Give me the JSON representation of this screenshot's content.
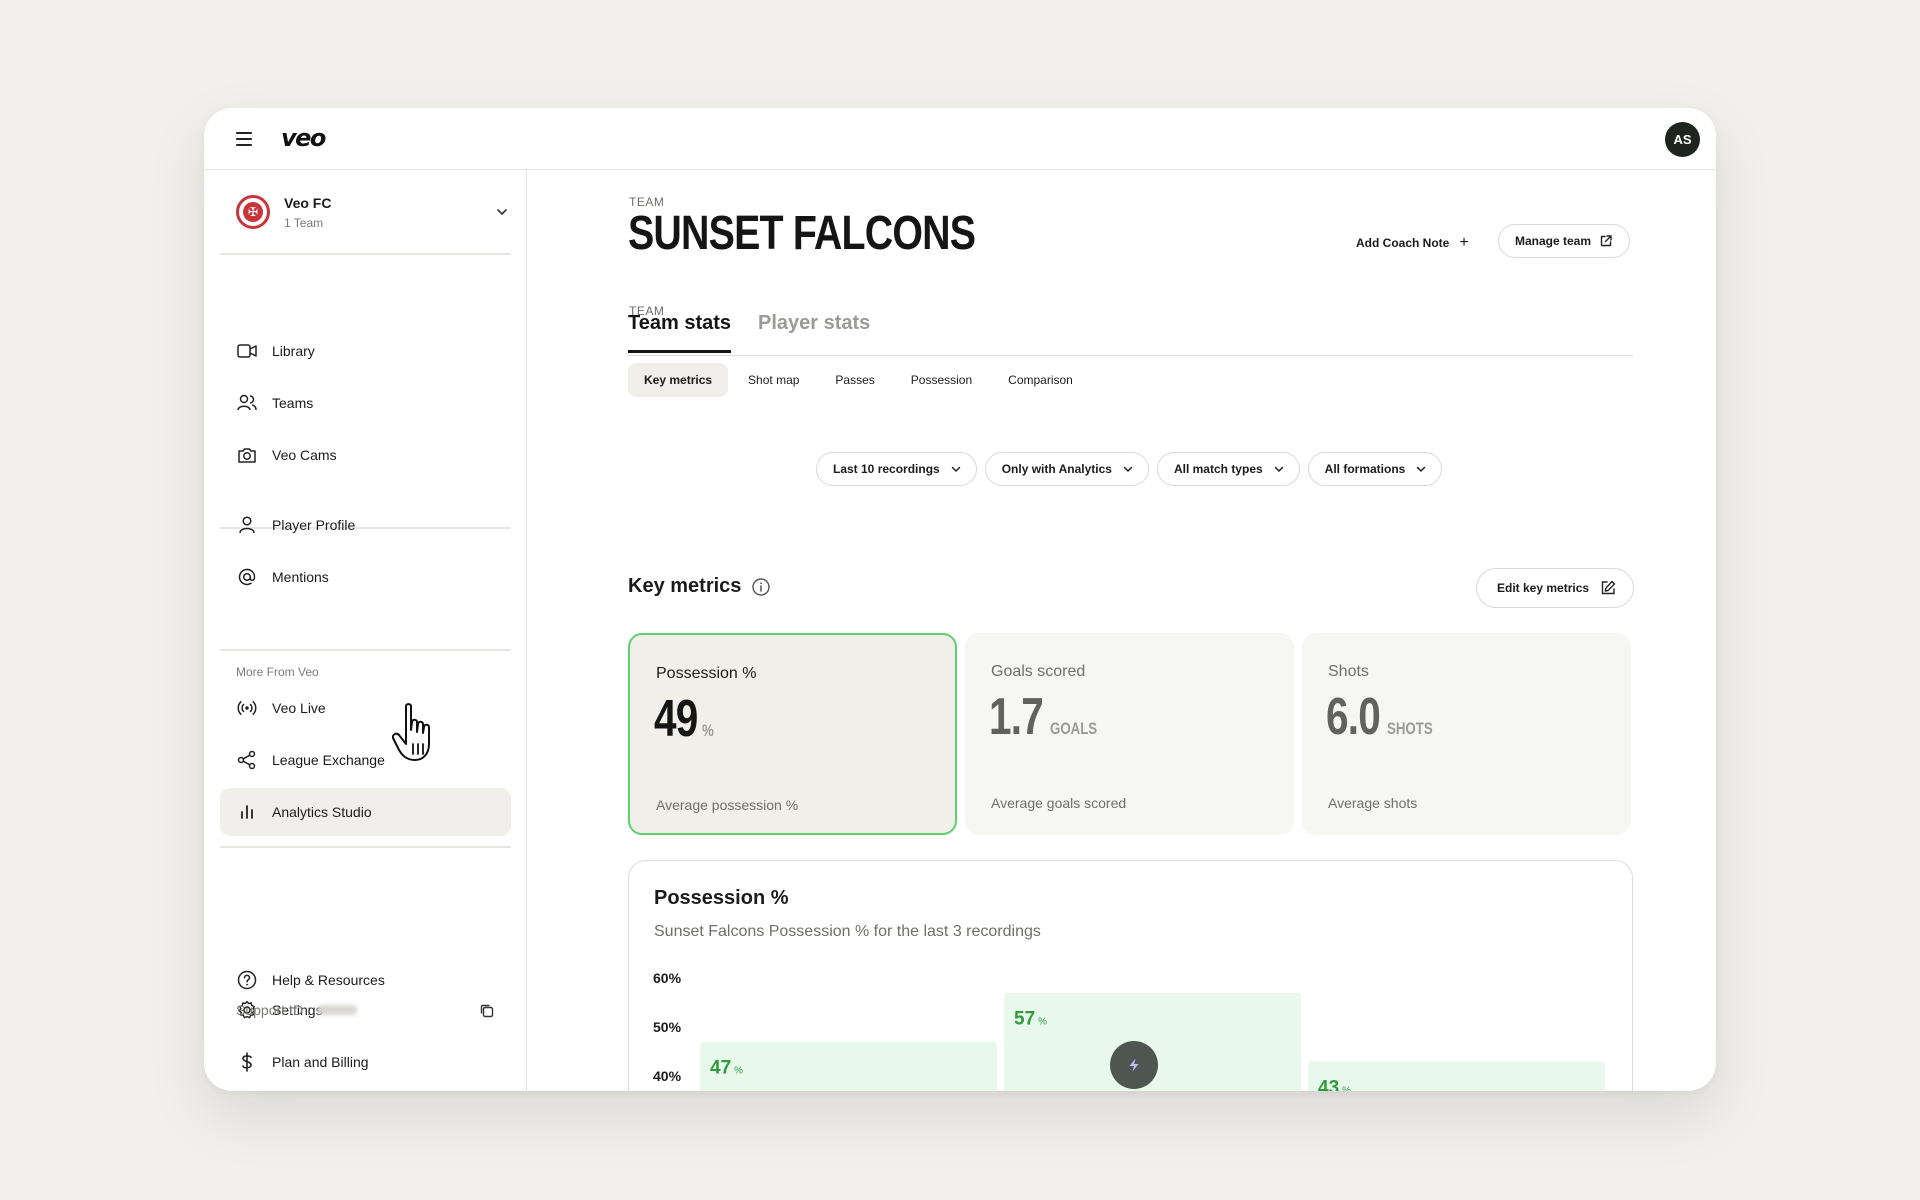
{
  "app": {
    "logo": "veo",
    "avatar_initials": "AS"
  },
  "club": {
    "name": "Veo FC",
    "subtitle": "1 Team"
  },
  "sidebar": {
    "items": [
      {
        "label": "Library",
        "icon": "video-camera-icon"
      },
      {
        "label": "Teams",
        "icon": "users-icon"
      },
      {
        "label": "Veo Cams",
        "icon": "camera-icon"
      },
      {
        "label": "Player Profile",
        "icon": "user-icon"
      },
      {
        "label": "Mentions",
        "icon": "at-sign-icon"
      }
    ],
    "more_label": "More From Veo",
    "more_items": [
      {
        "label": "Veo Live",
        "icon": "broadcast-icon"
      },
      {
        "label": "League Exchange",
        "icon": "share-icon"
      },
      {
        "label": "Analytics Studio",
        "icon": "bar-chart-icon",
        "active": true
      }
    ],
    "bottom_items": [
      {
        "label": "Settings",
        "icon": "gear-icon"
      },
      {
        "label": "Plan and Billing",
        "icon": "dollar-icon"
      },
      {
        "label": "Help & Resources",
        "icon": "help-circle-icon"
      }
    ],
    "support_label": "Support ID :"
  },
  "header": {
    "eyebrow": "TEAM",
    "title": "SUNSET FALCONS",
    "add_coach_note": "Add Coach Note",
    "manage_team": "Manage team"
  },
  "tabs": [
    {
      "label": "Team stats",
      "active": true
    },
    {
      "label": "Player stats",
      "active": false
    }
  ],
  "subtabs": [
    "Key metrics",
    "Shot map",
    "Passes",
    "Possession",
    "Comparison"
  ],
  "filters": [
    "Last 10 recordings",
    "Only with Analytics",
    "All match types",
    "All formations"
  ],
  "key_metrics": {
    "title": "Key metrics",
    "edit_label": "Edit key metrics",
    "cards": [
      {
        "label": "Possession %",
        "value": "49",
        "unit": "%",
        "sub": "Average possession %",
        "selected": true
      },
      {
        "label": "Goals scored",
        "value": "1.7",
        "unit": "GOALS",
        "sub": "Average goals scored",
        "selected": false
      },
      {
        "label": "Shots",
        "value": "6.0",
        "unit": "SHOTS",
        "sub": "Average shots",
        "selected": false
      }
    ]
  },
  "chart": {
    "title": "Possession %",
    "subtitle": "Sunset Falcons Possession % for the last 3 recordings"
  },
  "chart_data": {
    "type": "bar",
    "title": "Possession %",
    "subtitle": "Sunset Falcons Possession % for the last 3 recordings",
    "y_ticks": [
      "60%",
      "50%",
      "40%"
    ],
    "values": [
      47,
      57,
      43
    ],
    "value_unit": "%",
    "ylim": [
      0,
      60
    ],
    "colors": {
      "bar_fill": "#e8f8ea",
      "label": "#2e9c3e"
    }
  },
  "colors": {
    "accent_green": "#5fd06f",
    "dark": "#1f2421"
  }
}
